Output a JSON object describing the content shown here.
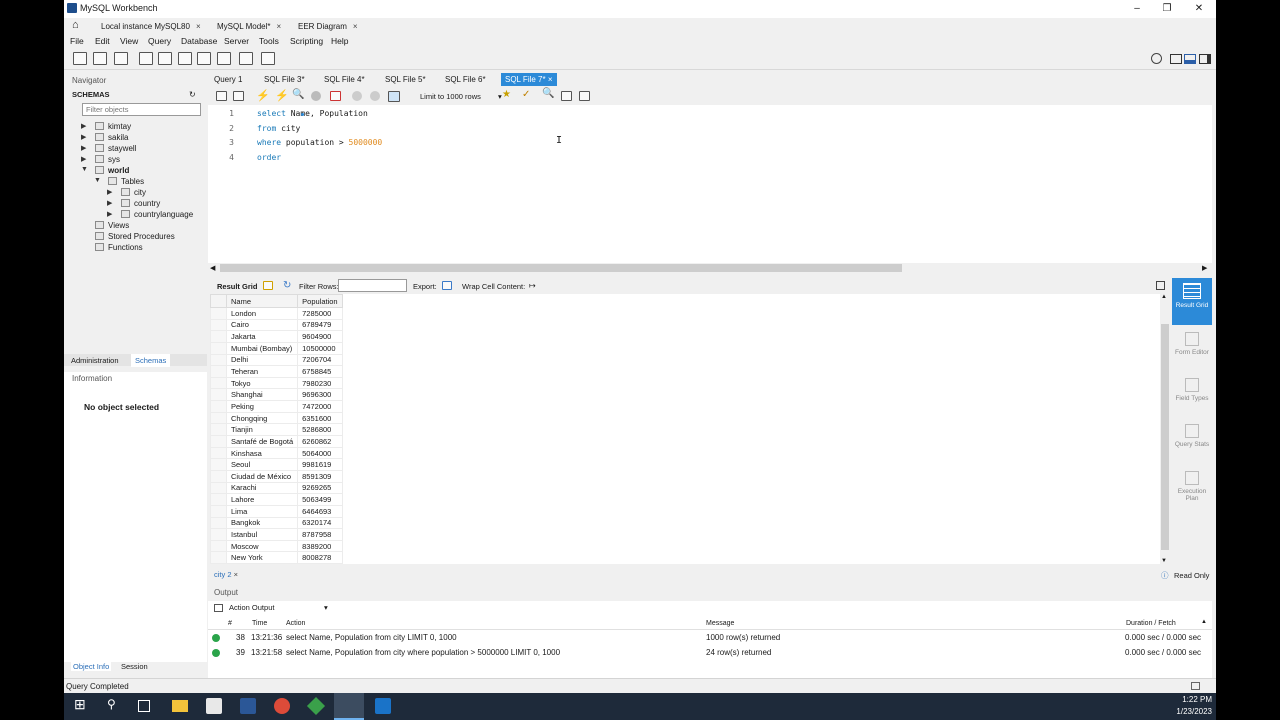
{
  "window": {
    "title": "MySQL Workbench"
  },
  "conn_tabs": [
    {
      "label": "Local instance MySQL80"
    },
    {
      "label": "MySQL Model*"
    },
    {
      "label": "EER Diagram"
    }
  ],
  "menu": [
    "File",
    "Edit",
    "View",
    "Query",
    "Database",
    "Server",
    "Tools",
    "Scripting",
    "Help"
  ],
  "navigator": {
    "title": "Navigator",
    "schemas_label": "SCHEMAS",
    "filter_placeholder": "Filter objects",
    "schemas": [
      "kimtay",
      "sakila",
      "staywell",
      "sys",
      "world"
    ],
    "world_children": {
      "tables_label": "Tables",
      "tables": [
        "city",
        "country",
        "countrylanguage"
      ],
      "others": [
        "Views",
        "Stored Procedures",
        "Functions"
      ]
    },
    "tabs": [
      "Administration",
      "Schemas"
    ],
    "info_label": "Information",
    "info_text": "No object selected",
    "bottom_tabs": [
      "Object Info",
      "Session"
    ]
  },
  "editor_tabs": [
    "Query 1",
    "SQL File 3*",
    "SQL File 4*",
    "SQL File 5*",
    "SQL File 6*",
    "SQL File 7*"
  ],
  "limit_label": "Limit to 1000 rows",
  "code_lines": [
    {
      "num": "1",
      "parts": [
        [
          "kw",
          "select"
        ],
        [
          "t",
          " Name, Population"
        ]
      ]
    },
    {
      "num": "2",
      "parts": [
        [
          "kw",
          "from"
        ],
        [
          "t",
          " city"
        ]
      ]
    },
    {
      "num": "3",
      "parts": [
        [
          "kw",
          "where"
        ],
        [
          "t",
          " population > "
        ],
        [
          "num",
          "5000000"
        ]
      ]
    },
    {
      "num": "4",
      "parts": [
        [
          "kw",
          "order"
        ]
      ]
    }
  ],
  "result_bar": {
    "grid_label": "Result Grid",
    "filter_label": "Filter Rows:",
    "export_label": "Export:",
    "wrap_label": "Wrap Cell Content:"
  },
  "grid": {
    "columns": [
      "Name",
      "Population"
    ],
    "rows": [
      [
        "London",
        "7285000"
      ],
      [
        "Cairo",
        "6789479"
      ],
      [
        "Jakarta",
        "9604900"
      ],
      [
        "Mumbai (Bombay)",
        "10500000"
      ],
      [
        "Delhi",
        "7206704"
      ],
      [
        "Teheran",
        "6758845"
      ],
      [
        "Tokyo",
        "7980230"
      ],
      [
        "Shanghai",
        "9696300"
      ],
      [
        "Peking",
        "7472000"
      ],
      [
        "Chongqing",
        "6351600"
      ],
      [
        "Tianjin",
        "5286800"
      ],
      [
        "Santafé de Bogotá",
        "6260862"
      ],
      [
        "Kinshasa",
        "5064000"
      ],
      [
        "Seoul",
        "9981619"
      ],
      [
        "Ciudad de México",
        "8591309"
      ],
      [
        "Karachi",
        "9269265"
      ],
      [
        "Lahore",
        "5063499"
      ],
      [
        "Lima",
        "6464693"
      ],
      [
        "Bangkok",
        "6320174"
      ],
      [
        "Istanbul",
        "8787958"
      ],
      [
        "Moscow",
        "8389200"
      ],
      [
        "New York",
        "8008278"
      ]
    ]
  },
  "side_buttons": [
    "Result Grid",
    "Form Editor",
    "Field Types",
    "Query Stats",
    "Execution Plan"
  ],
  "result_tab": "city 2",
  "read_only": "Read Only",
  "output": {
    "title": "Output",
    "select_label": "Action Output",
    "headers": [
      "#",
      "Time",
      "Action",
      "Message",
      "Duration / Fetch"
    ],
    "rows": [
      {
        "num": "38",
        "time": "13:21:36",
        "action": "select Name, Population from city LIMIT 0, 1000",
        "message": "1000 row(s) returned",
        "duration": "0.000 sec / 0.000 sec"
      },
      {
        "num": "39",
        "time": "13:21:58",
        "action": "select Name, Population from city where population > 5000000 LIMIT 0, 1000",
        "message": "24 row(s) returned",
        "duration": "0.000 sec / 0.000 sec"
      }
    ]
  },
  "status": "Query Completed",
  "clock": {
    "time": "1:22 PM",
    "date": "1/23/2023"
  },
  "colors": {
    "accent": "#2c8ad8",
    "taskbar": "#1e2a3a",
    "ok": "#2aa44a"
  }
}
